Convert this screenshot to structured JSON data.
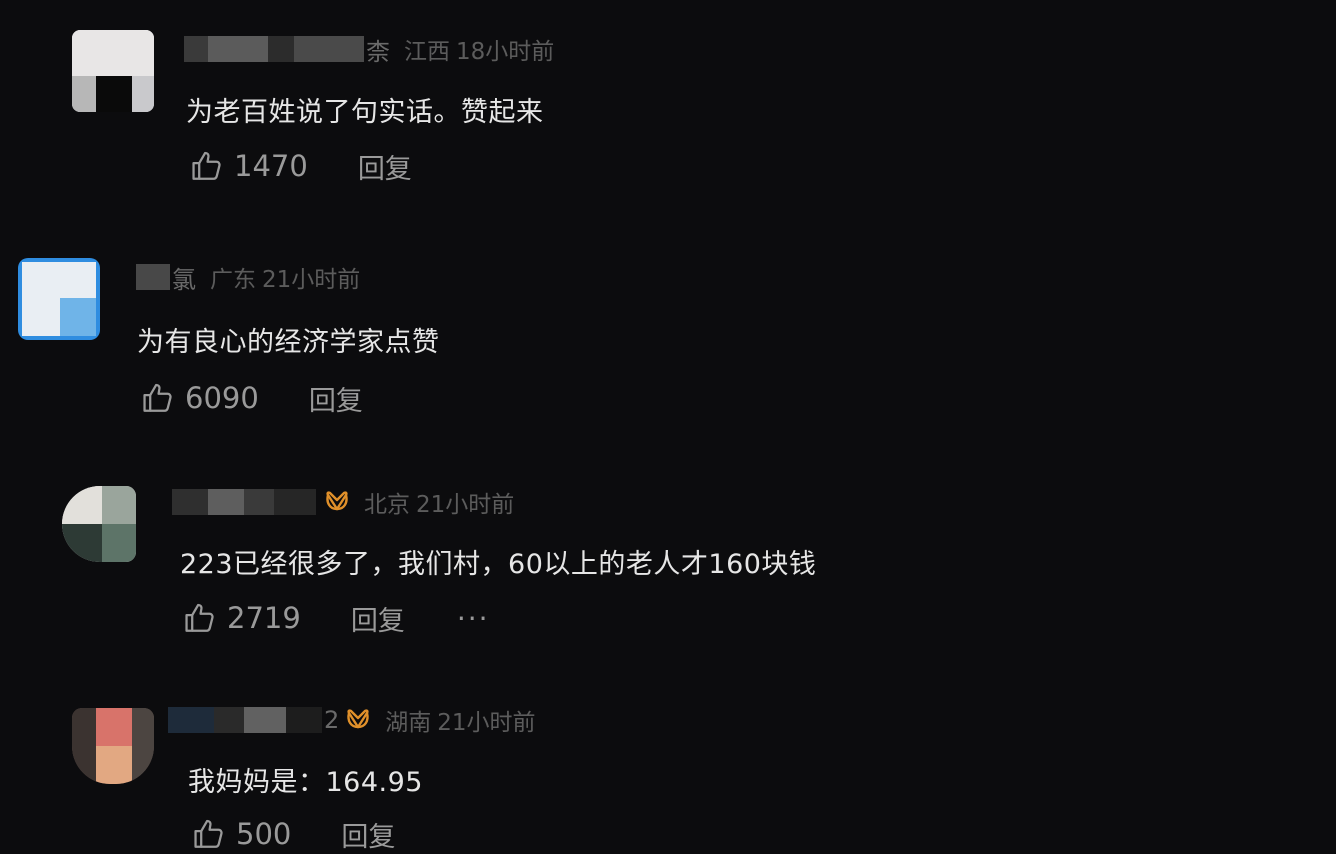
{
  "comments": [
    {
      "user_suffix": "柰",
      "location": "江西",
      "time": "18小时前",
      "text": "为老百姓说了句实话。赞起来",
      "likes": "1470",
      "reply_label": "回复"
    },
    {
      "user_suffix": "氯",
      "location": "广东",
      "time": "21小时前",
      "text": "为有良心的经济学家点赞",
      "likes": "6090",
      "reply_label": "回复"
    },
    {
      "user_suffix": "",
      "location": "北京",
      "time": "21小时前",
      "text": "223已经很多了，我们村，60以上的老人才160块钱",
      "likes": "2719",
      "reply_label": "回复",
      "more_label": "···"
    },
    {
      "user_suffix": "2",
      "location": "湖南",
      "time": "21小时前",
      "text": "我妈妈是：164.95",
      "likes": "500",
      "reply_label": "回复"
    }
  ],
  "colors": {
    "background": "#0c0c0e",
    "badge": "#e0902a",
    "text": "#e6e6e6",
    "meta": "#5c5c5c",
    "action": "#9a9a9a"
  },
  "icons": {
    "like": "thumbs-up-icon",
    "badge": "butterfly-badge-icon",
    "more": "more-dots-icon"
  }
}
